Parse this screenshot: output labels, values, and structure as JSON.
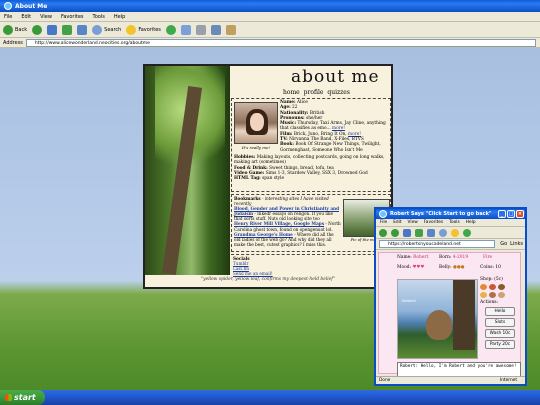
{
  "ie": {
    "title": "About Me",
    "menu": [
      "File",
      "Edit",
      "View",
      "Favorites",
      "Tools",
      "Help"
    ],
    "toolbar": {
      "back": "Back",
      "search": "Search",
      "favorites": "Favorites"
    },
    "address_label": "Address",
    "address": "http://www.alicewonderland.neocities.org/aboutme"
  },
  "page": {
    "title": "about me",
    "nav": [
      "home",
      "profile",
      "quizzes"
    ],
    "avatar_caption": "It's really me!",
    "facts": [
      {
        "label": "Name:",
        "value": "Alice"
      },
      {
        "label": "Age:",
        "value": "22"
      },
      {
        "label": "Nationality:",
        "value": "British"
      },
      {
        "label": "Pronouns:",
        "value": "she/her"
      },
      {
        "label": "Music:",
        "value": "Thursday, Taxi Arms, Jay Cline, anything that classifies as emo...",
        "more": "more!"
      },
      {
        "label": "Film:",
        "value": "Brick, Juno, Bring It On,",
        "more": "more!"
      },
      {
        "label": "TV:",
        "value": "Nirvanna The Band, X-Files, BTVS"
      },
      {
        "label": "Book:",
        "value": "Book Of Strange New Things, Twilight, Gormenghast, Someone Who Isn't Me"
      }
    ],
    "facts_bottom": [
      {
        "label": "Hobbies:",
        "value": "Making layouts, collecting postcards, going on long walks, making art (sometimes)"
      },
      {
        "label": "Food & Drink:",
        "value": "Sweet things, bread, tofu, tea"
      },
      {
        "label": "Video Game:",
        "value": "Sims 1-3, Stardew Valley, SSX 3, Drowned God"
      },
      {
        "label": "HTML Tag:",
        "value": "span style"
      }
    ],
    "bookmarks": {
      "label": "Bookmarks",
      "intro": " - interesting sites I have visited recently",
      "items": [
        {
          "title": "Blood, Gender and Power in Christianity and Judaism",
          "desc": " - Inkedr essays on religon. If you like that sorts stuff. Nuts old looking site too"
        },
        {
          "title": "Henry River Mill Village, Google Maps",
          "desc": " - North Carolina ghost town, found on opengenuot lol."
        },
        {
          "title": "Grandma George's Home",
          "desc": " - Where did all the old ladies of the web go? And why did they all make the best, cutest graphics? I miss this."
        }
      ],
      "photo_caption": "Pic of the month"
    },
    "socials": {
      "label": "Socials",
      "links": [
        "Tumblr",
        "Last.fm",
        "Send me an email!"
      ]
    },
    "quote": "\"yellow spider, yellow leaf, confirms my deepest-held belief\""
  },
  "robert": {
    "title": "Robert Says \"Click Start to go back\"",
    "menu": [
      "File",
      "Edit",
      "View",
      "Favorites",
      "Tools",
      "Help"
    ],
    "address": "https://robertsnyoucadeland.net",
    "go": "Go",
    "links": "Links",
    "stats": {
      "name_label": "Name:",
      "name": "Robert",
      "born_label": "Born:",
      "born": "4-2019",
      "mood_label": "Mood:",
      "mood": "♥♥♥",
      "belly_label": "Belly:",
      "belly": "●●●",
      "fire_label": "Fire",
      "fire": "",
      "coins_label": "Coins:",
      "coins": "10",
      "shop_label": "Shop: (5c)",
      "actions_label": "Actions:"
    },
    "scene_label": "Robert",
    "actions": [
      "Hello",
      "Slots",
      "Wash 10c",
      "Party 20c"
    ],
    "speech": "Robert: Hello, I'm Robert and you're awesome!",
    "status_done": "Done",
    "status_zone": "Internet"
  },
  "taskbar": {
    "start": "start"
  }
}
